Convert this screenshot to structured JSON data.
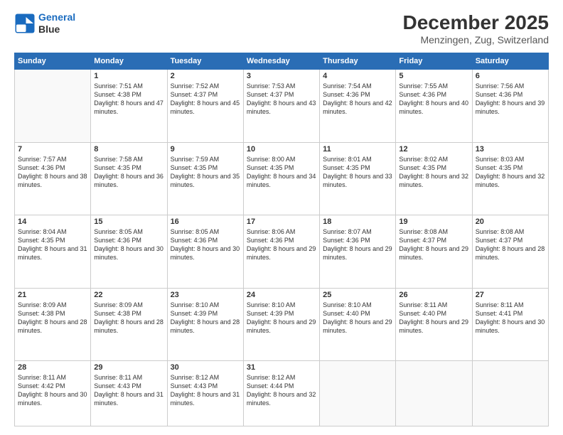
{
  "logo": {
    "line1": "General",
    "line2": "Blue"
  },
  "title": "December 2025",
  "location": "Menzingen, Zug, Switzerland",
  "weekdays": [
    "Sunday",
    "Monday",
    "Tuesday",
    "Wednesday",
    "Thursday",
    "Friday",
    "Saturday"
  ],
  "weeks": [
    [
      {
        "day": "",
        "sunrise": "",
        "sunset": "",
        "daylight": ""
      },
      {
        "day": "1",
        "sunrise": "Sunrise: 7:51 AM",
        "sunset": "Sunset: 4:38 PM",
        "daylight": "Daylight: 8 hours and 47 minutes."
      },
      {
        "day": "2",
        "sunrise": "Sunrise: 7:52 AM",
        "sunset": "Sunset: 4:37 PM",
        "daylight": "Daylight: 8 hours and 45 minutes."
      },
      {
        "day": "3",
        "sunrise": "Sunrise: 7:53 AM",
        "sunset": "Sunset: 4:37 PM",
        "daylight": "Daylight: 8 hours and 43 minutes."
      },
      {
        "day": "4",
        "sunrise": "Sunrise: 7:54 AM",
        "sunset": "Sunset: 4:36 PM",
        "daylight": "Daylight: 8 hours and 42 minutes."
      },
      {
        "day": "5",
        "sunrise": "Sunrise: 7:55 AM",
        "sunset": "Sunset: 4:36 PM",
        "daylight": "Daylight: 8 hours and 40 minutes."
      },
      {
        "day": "6",
        "sunrise": "Sunrise: 7:56 AM",
        "sunset": "Sunset: 4:36 PM",
        "daylight": "Daylight: 8 hours and 39 minutes."
      }
    ],
    [
      {
        "day": "7",
        "sunrise": "Sunrise: 7:57 AM",
        "sunset": "Sunset: 4:36 PM",
        "daylight": "Daylight: 8 hours and 38 minutes."
      },
      {
        "day": "8",
        "sunrise": "Sunrise: 7:58 AM",
        "sunset": "Sunset: 4:35 PM",
        "daylight": "Daylight: 8 hours and 36 minutes."
      },
      {
        "day": "9",
        "sunrise": "Sunrise: 7:59 AM",
        "sunset": "Sunset: 4:35 PM",
        "daylight": "Daylight: 8 hours and 35 minutes."
      },
      {
        "day": "10",
        "sunrise": "Sunrise: 8:00 AM",
        "sunset": "Sunset: 4:35 PM",
        "daylight": "Daylight: 8 hours and 34 minutes."
      },
      {
        "day": "11",
        "sunrise": "Sunrise: 8:01 AM",
        "sunset": "Sunset: 4:35 PM",
        "daylight": "Daylight: 8 hours and 33 minutes."
      },
      {
        "day": "12",
        "sunrise": "Sunrise: 8:02 AM",
        "sunset": "Sunset: 4:35 PM",
        "daylight": "Daylight: 8 hours and 32 minutes."
      },
      {
        "day": "13",
        "sunrise": "Sunrise: 8:03 AM",
        "sunset": "Sunset: 4:35 PM",
        "daylight": "Daylight: 8 hours and 32 minutes."
      }
    ],
    [
      {
        "day": "14",
        "sunrise": "Sunrise: 8:04 AM",
        "sunset": "Sunset: 4:35 PM",
        "daylight": "Daylight: 8 hours and 31 minutes."
      },
      {
        "day": "15",
        "sunrise": "Sunrise: 8:05 AM",
        "sunset": "Sunset: 4:36 PM",
        "daylight": "Daylight: 8 hours and 30 minutes."
      },
      {
        "day": "16",
        "sunrise": "Sunrise: 8:05 AM",
        "sunset": "Sunset: 4:36 PM",
        "daylight": "Daylight: 8 hours and 30 minutes."
      },
      {
        "day": "17",
        "sunrise": "Sunrise: 8:06 AM",
        "sunset": "Sunset: 4:36 PM",
        "daylight": "Daylight: 8 hours and 29 minutes."
      },
      {
        "day": "18",
        "sunrise": "Sunrise: 8:07 AM",
        "sunset": "Sunset: 4:36 PM",
        "daylight": "Daylight: 8 hours and 29 minutes."
      },
      {
        "day": "19",
        "sunrise": "Sunrise: 8:08 AM",
        "sunset": "Sunset: 4:37 PM",
        "daylight": "Daylight: 8 hours and 29 minutes."
      },
      {
        "day": "20",
        "sunrise": "Sunrise: 8:08 AM",
        "sunset": "Sunset: 4:37 PM",
        "daylight": "Daylight: 8 hours and 28 minutes."
      }
    ],
    [
      {
        "day": "21",
        "sunrise": "Sunrise: 8:09 AM",
        "sunset": "Sunset: 4:38 PM",
        "daylight": "Daylight: 8 hours and 28 minutes."
      },
      {
        "day": "22",
        "sunrise": "Sunrise: 8:09 AM",
        "sunset": "Sunset: 4:38 PM",
        "daylight": "Daylight: 8 hours and 28 minutes."
      },
      {
        "day": "23",
        "sunrise": "Sunrise: 8:10 AM",
        "sunset": "Sunset: 4:39 PM",
        "daylight": "Daylight: 8 hours and 28 minutes."
      },
      {
        "day": "24",
        "sunrise": "Sunrise: 8:10 AM",
        "sunset": "Sunset: 4:39 PM",
        "daylight": "Daylight: 8 hours and 29 minutes."
      },
      {
        "day": "25",
        "sunrise": "Sunrise: 8:10 AM",
        "sunset": "Sunset: 4:40 PM",
        "daylight": "Daylight: 8 hours and 29 minutes."
      },
      {
        "day": "26",
        "sunrise": "Sunrise: 8:11 AM",
        "sunset": "Sunset: 4:40 PM",
        "daylight": "Daylight: 8 hours and 29 minutes."
      },
      {
        "day": "27",
        "sunrise": "Sunrise: 8:11 AM",
        "sunset": "Sunset: 4:41 PM",
        "daylight": "Daylight: 8 hours and 30 minutes."
      }
    ],
    [
      {
        "day": "28",
        "sunrise": "Sunrise: 8:11 AM",
        "sunset": "Sunset: 4:42 PM",
        "daylight": "Daylight: 8 hours and 30 minutes."
      },
      {
        "day": "29",
        "sunrise": "Sunrise: 8:11 AM",
        "sunset": "Sunset: 4:43 PM",
        "daylight": "Daylight: 8 hours and 31 minutes."
      },
      {
        "day": "30",
        "sunrise": "Sunrise: 8:12 AM",
        "sunset": "Sunset: 4:43 PM",
        "daylight": "Daylight: 8 hours and 31 minutes."
      },
      {
        "day": "31",
        "sunrise": "Sunrise: 8:12 AM",
        "sunset": "Sunset: 4:44 PM",
        "daylight": "Daylight: 8 hours and 32 minutes."
      },
      {
        "day": "",
        "sunrise": "",
        "sunset": "",
        "daylight": ""
      },
      {
        "day": "",
        "sunrise": "",
        "sunset": "",
        "daylight": ""
      },
      {
        "day": "",
        "sunrise": "",
        "sunset": "",
        "daylight": ""
      }
    ]
  ]
}
